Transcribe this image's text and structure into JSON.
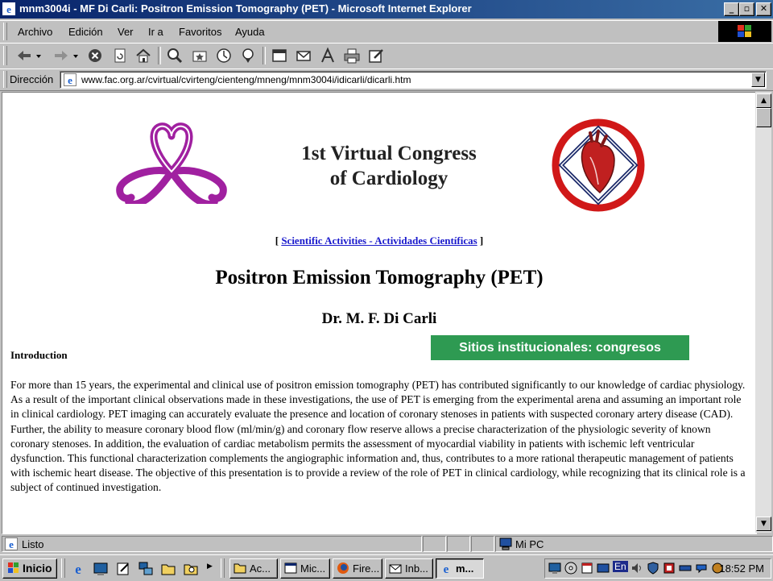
{
  "window": {
    "title": "mnm3004i - MF Di Carli: Positron Emission Tomography (PET) - Microsoft Internet Explorer",
    "minimize": "_",
    "maximize": "▫",
    "close": "✕"
  },
  "menu": {
    "items": [
      "Archivo",
      "Edición",
      "Ver",
      "Ir a",
      "Favoritos",
      "Ayuda"
    ]
  },
  "address": {
    "label": "Dirección",
    "url": "www.fac.org.ar/cvirtual/cvirteng/cienteng/mneng/mnm3004i/idicarli/dicarli.htm"
  },
  "page": {
    "congress_line1": "1st Virtual Congress",
    "congress_line2": "of Cardiology",
    "nav_open": "[ ",
    "nav_link": "Scientific Activities - Actividades Científicas",
    "nav_close": " ]",
    "title": "Positron Emission Tomography (PET)",
    "author": "Dr. M. F. Di Carli",
    "intro_heading": "Introduction",
    "intro_text": "For more than 15 years, the experimental and clinical use of positron emission tomography (PET) has contributed significantly to our knowledge of cardiac physiology. As a result of the important clinical observations made in these investigations, the use of PET is emerging from the experimental arena and assuming an important role in clinical cardiology. PET imaging can accurately evaluate the presence and location of coronary stenoses in patients with suspected coronary artery disease (CAD). Further, the ability to measure coronary blood flow (ml/min/g) and coronary flow reserve allows a precise characterization of the physiologic severity of known coronary stenoses. In addition, the evaluation of cardiac metabolism permits the assessment of myocardial viability in patients with ischemic left ventricular dysfunction. This functional characterization complements the angiographic information and, thus, contributes to a more rational therapeutic management of patients with ischemic heart disease. The objective of this presentation is to provide a review of the role of PET in clinical cardiology, while recognizing that its clinical role is a subject of continued investigation."
  },
  "banner": {
    "text": "Sitios institucionales: congresos",
    "color": "#2e9a52"
  },
  "status": {
    "text": "Listo",
    "zone": "Mi PC"
  },
  "taskbar": {
    "start": "Inicio",
    "tasks": [
      "Ac...",
      "Mic...",
      "Fire...",
      "Inb...",
      "m..."
    ],
    "clock": "18:52 PM",
    "lang": "En"
  },
  "colors": {
    "titlebar_start": "#08246b",
    "titlebar_end": "#3a6ea5",
    "chrome": "#c0c0c0",
    "link": "#1a1acc",
    "logo_purple": "#a020a0",
    "logo_red": "#d01818",
    "logo_navy": "#1c2a6a"
  }
}
